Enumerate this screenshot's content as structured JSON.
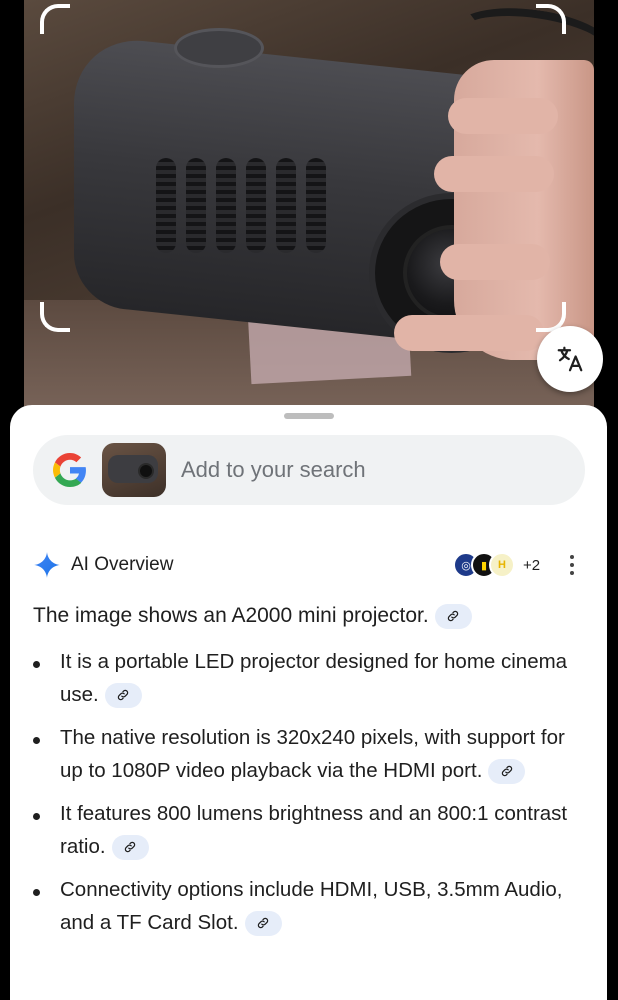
{
  "camera": {
    "translate_icon": "translate-icon"
  },
  "search": {
    "placeholder": "Add to your search",
    "logo_icon": "google-g-icon",
    "thumbnail": "projector-thumbnail"
  },
  "ai_overview": {
    "title": "AI Overview",
    "icon": "sparkle-icon",
    "sources_more": "+2",
    "menu_icon": "more-vert-icon",
    "intro": "The image shows an A2000 mini projector.",
    "bullets": [
      "It is a portable LED projector designed for home cinema use.",
      "The native resolution is 320x240 pixels, with support for up to 1080P video playback via the HDMI port.",
      "It features 800 lumens brightness and an 800:1 contrast ratio.",
      "Connectivity options include HDMI, USB, 3.5mm Audio, and a TF Card Slot."
    ]
  },
  "colors": {
    "accent_blue": "#4285F4",
    "chip_bg": "#e6edf9",
    "text": "#1f1f1f"
  }
}
